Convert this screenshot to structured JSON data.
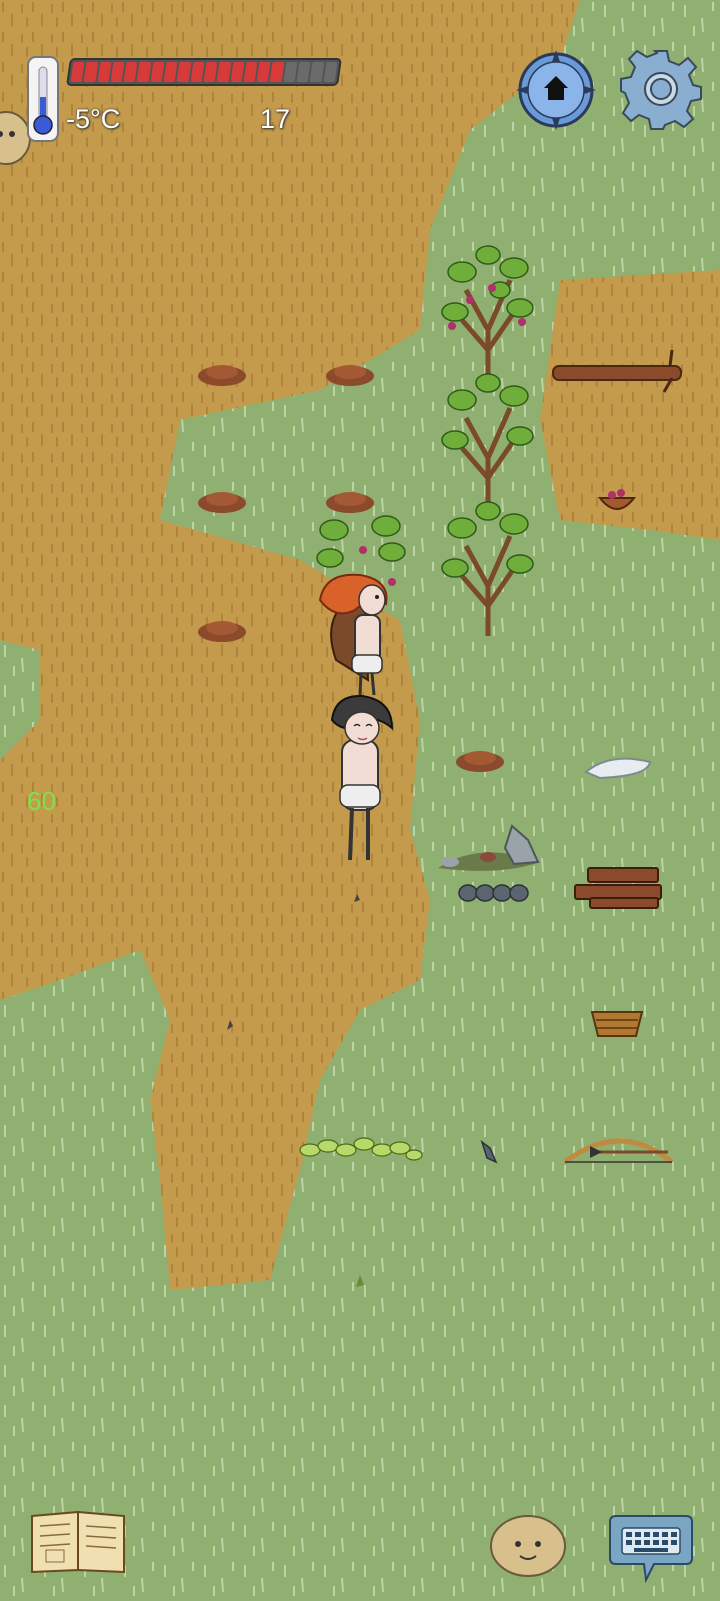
{
  "hud": {
    "temperature": "-5°C",
    "age": "17",
    "food_pips_total": 20,
    "food_pips_full": 16,
    "yum_counter": "60"
  },
  "icons": {
    "thermometer": "thermometer-icon",
    "home": "home-compass-icon",
    "settings": "gear-icon",
    "recipe_book": "book-icon",
    "emote": "emote-face-icon",
    "keyboard": "keyboard-icon"
  },
  "colors": {
    "grass": "#8fb070",
    "dirt": "#c49a4c",
    "food_full": "#d83a3a",
    "food_empty": "#6b6b6b",
    "yum": "#7ee04a"
  }
}
